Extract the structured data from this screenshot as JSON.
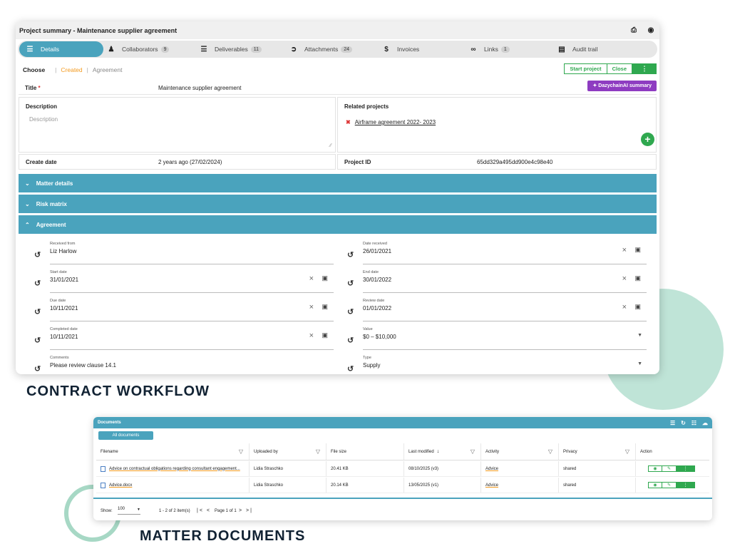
{
  "window": {
    "title": "Project summary - Maintenance supplier agreement",
    "print_icon": "printer-icon",
    "camera_icon": "camera-icon"
  },
  "tabs": [
    {
      "label": "Details",
      "icon": "list-icon",
      "active": true
    },
    {
      "label": "Collaborators",
      "icon": "person-icon",
      "badge": "9"
    },
    {
      "label": "Deliverables",
      "icon": "stack-icon",
      "badge": "11"
    },
    {
      "label": "Attachments",
      "icon": "paperclip-icon",
      "badge": "24"
    },
    {
      "label": "Invoices",
      "icon": "dollar-icon"
    },
    {
      "label": "Links",
      "icon": "link-icon",
      "badge": "1"
    },
    {
      "label": "Audit trail",
      "icon": "ledger-icon"
    }
  ],
  "choose": {
    "label": "Choose",
    "created": "Created",
    "agreement": "Agreement",
    "start_project": "Start project",
    "close": "Close",
    "more": "⋮"
  },
  "title_field": {
    "label": "Title",
    "required": "*",
    "value": "Maintenance supplier agreement"
  },
  "ai_button": "DazychainAI summary",
  "description": {
    "label": "Description",
    "placeholder": "Description"
  },
  "related": {
    "label": "Related projects",
    "link": "Airframe agreement 2022- 2023"
  },
  "create_date": {
    "label": "Create date",
    "value": "2 years ago (27/02/2024)"
  },
  "project_id": {
    "label": "Project ID",
    "value": "65dd329a495dd900e4c98e40"
  },
  "accordions": {
    "matter_details": "Matter details",
    "risk_matrix": "Risk matrix",
    "agreement": "Agreement"
  },
  "fields": {
    "received_from": {
      "label": "Received from",
      "value": "Liz Harlow"
    },
    "date_received": {
      "label": "Date received",
      "value": "26/01/2021"
    },
    "start_date": {
      "label": "Start date",
      "value": "31/01/2021"
    },
    "end_date": {
      "label": "End date",
      "value": "30/01/2022"
    },
    "due_date": {
      "label": "Due date",
      "value": "10/11/2021"
    },
    "review_date": {
      "label": "Review date",
      "value": "01/01/2022"
    },
    "completed_date": {
      "label": "Completed date",
      "value": "10/11/2021"
    },
    "value": {
      "label": "Value",
      "value": "$0 – $10,000"
    },
    "comments": {
      "label": "Comments",
      "value": "Please review clause 14.1"
    },
    "type": {
      "label": "Type",
      "value": "Supply"
    }
  },
  "captions": {
    "contract_workflow": "CONTRACT WORKFLOW",
    "matter_documents": "MATTER DOCUMENTS"
  },
  "documents": {
    "title": "Documents",
    "all_documents": "All documents",
    "columns": {
      "filename": "Filename",
      "uploaded_by": "Uploaded by",
      "file_size": "File size",
      "last_modified": "Last modified",
      "activity": "Activity",
      "privacy": "Privacy",
      "action": "Action"
    },
    "rows": [
      {
        "filename": "Advice on contractual obligations regarding consultant engagement...",
        "uploaded_by": "Lidia Straschko",
        "file_size": "20.41 KB",
        "last_modified": "08/10/2025 (v3)",
        "activity": "Advice",
        "privacy": "shared"
      },
      {
        "filename": "Advice.docx",
        "uploaded_by": "Lidia Straschko",
        "file_size": "20.14 KB",
        "last_modified": "13/05/2025 (v1)",
        "activity": "Advice",
        "privacy": "shared"
      }
    ],
    "footer": {
      "show": "Show:",
      "page_size": "100",
      "items": "1 - 2 of 2 item(s)",
      "page": "Page 1 of 1"
    }
  },
  "colors": {
    "teal": "#4aa3bd",
    "green": "#2fa84f",
    "purple": "#8e3cc1",
    "orange": "#f39a1e"
  }
}
